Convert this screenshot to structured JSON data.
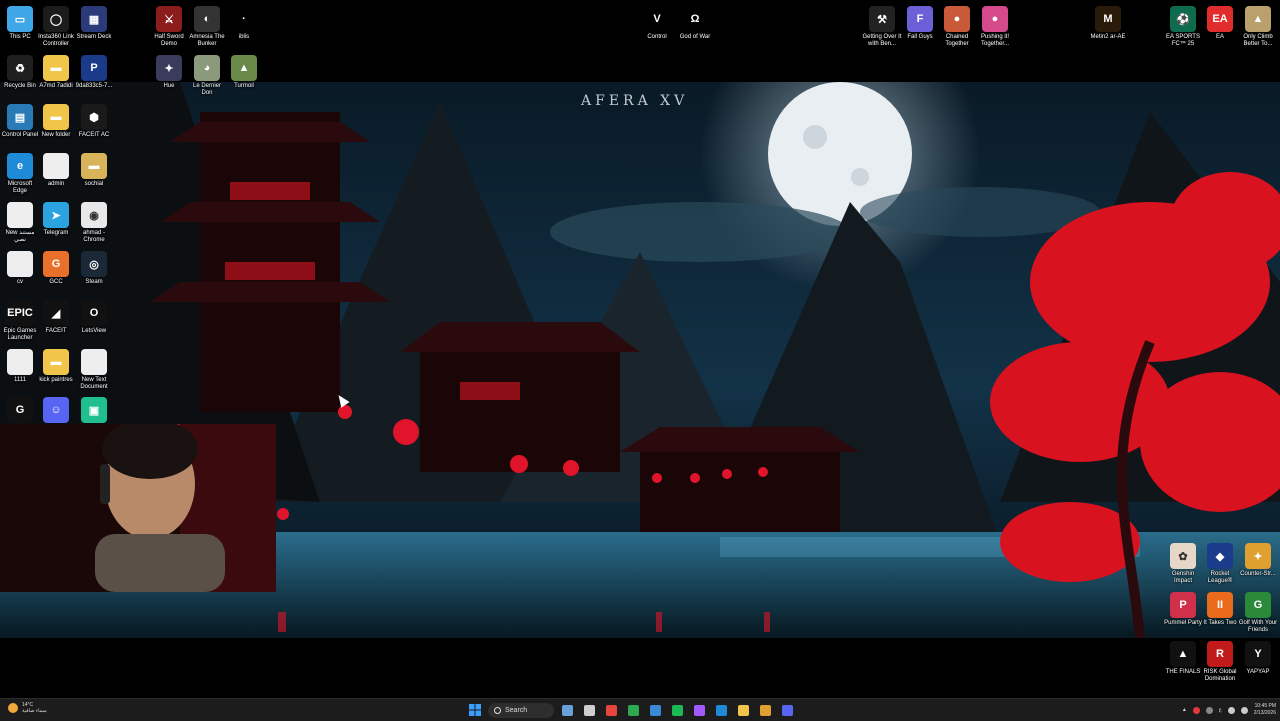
{
  "wallpaper": {
    "title": "AFERA XV"
  },
  "desktop": {
    "icons": [
      {
        "id": "this-pc",
        "label": "This PC",
        "color": "#3fa7e8",
        "glyph": "▭"
      },
      {
        "id": "insta360",
        "label": "Insta360 Link Controller",
        "color": "#1c1c1c",
        "glyph": "◯"
      },
      {
        "id": "stream-deck",
        "label": "Stream Deck",
        "color": "#2b3a78",
        "glyph": "▦"
      },
      {
        "id": "half-sword",
        "label": "Half Sword Demo",
        "color": "#8c1d1d",
        "glyph": "⚔"
      },
      {
        "id": "amnesia",
        "label": "Amnesia The Bunker",
        "color": "#333",
        "glyph": "◐"
      },
      {
        "id": "iblis",
        "label": "iblis",
        "color": "#000",
        "glyph": "·"
      },
      {
        "id": "control",
        "label": "Control",
        "color": "#000",
        "glyph": "V"
      },
      {
        "id": "god-of-war",
        "label": "God of War",
        "color": "#000",
        "glyph": "Ω"
      },
      {
        "id": "getting-over-it",
        "label": "Getting Over It with Ben...",
        "color": "#222",
        "glyph": "⚒"
      },
      {
        "id": "fall-guys",
        "label": "Fall Guys",
        "color": "#6c5fd8",
        "glyph": "F"
      },
      {
        "id": "chained-together",
        "label": "Chained Together",
        "color": "#c85a3a",
        "glyph": "●"
      },
      {
        "id": "pushing-it",
        "label": "Pushing it! Together...",
        "color": "#d54a8a",
        "glyph": "●"
      },
      {
        "id": "metin2",
        "label": "Metin2 ar-AE",
        "color": "#2a1a0a",
        "glyph": "M"
      },
      {
        "id": "ea-fc25",
        "label": "EA SPORTS FC™ 25",
        "color": "#0f6b4d",
        "glyph": "⚽"
      },
      {
        "id": "ea",
        "label": "EA",
        "color": "#e02c2c",
        "glyph": "EA"
      },
      {
        "id": "only-climb",
        "label": "Only Climb Better To...",
        "color": "#b9a06c",
        "glyph": "▲"
      },
      {
        "id": "recycle-bin",
        "label": "Recycle Bin",
        "color": "#1f1f1f",
        "glyph": "♻"
      },
      {
        "id": "a7md-folder",
        "label": "A7md 7adidi",
        "color": "#f0c54a",
        "glyph": "▬"
      },
      {
        "id": "pdf-file",
        "label": "9da833c5-7...",
        "color": "#1a3a8a",
        "glyph": "P"
      },
      {
        "id": "hue",
        "label": "Hue",
        "color": "#3b3b5b",
        "glyph": "✦"
      },
      {
        "id": "le-dernier-don",
        "label": "Le Dernier Don",
        "color": "#8a9a7a",
        "glyph": "◕"
      },
      {
        "id": "turmoil",
        "label": "Turmoil",
        "color": "#6a8a4a",
        "glyph": "▲"
      },
      {
        "id": "control-panel",
        "label": "Control Panel",
        "color": "#2a7ab8",
        "glyph": "▤"
      },
      {
        "id": "new-folder",
        "label": "New folder",
        "color": "#f0c54a",
        "glyph": "▬"
      },
      {
        "id": "faceit-ac",
        "label": "FACEIT AC",
        "color": "#1a1a1a",
        "glyph": "⬢"
      },
      {
        "id": "edge",
        "label": "Microsoft Edge",
        "color": "#1e8ad8",
        "glyph": "e"
      },
      {
        "id": "admin",
        "label": "admin",
        "color": "#eee",
        "glyph": ""
      },
      {
        "id": "sochial",
        "label": "sochial",
        "color": "#d8b35a",
        "glyph": "▬"
      },
      {
        "id": "new-doc-arabic",
        "label": "New مستند نصي",
        "color": "#eee",
        "glyph": ""
      },
      {
        "id": "telegram",
        "label": "Telegram",
        "color": "#2aa3e0",
        "glyph": "➤"
      },
      {
        "id": "chrome-ahmad",
        "label": "ahmad - Chrome",
        "color": "#e8e8e8",
        "glyph": "◉"
      },
      {
        "id": "cv",
        "label": "cv",
        "color": "#eee",
        "glyph": ""
      },
      {
        "id": "gcc",
        "label": "GCC",
        "color": "#e8702a",
        "glyph": "G"
      },
      {
        "id": "steam",
        "label": "Steam",
        "color": "#1b2838",
        "glyph": "◎"
      },
      {
        "id": "epic-games",
        "label": "Epic Games Launcher",
        "color": "#111",
        "glyph": "EPIC"
      },
      {
        "id": "faceit",
        "label": "FACEIT",
        "color": "#111",
        "glyph": "◢"
      },
      {
        "id": "letsview",
        "label": "LetsView",
        "color": "#111",
        "glyph": "O"
      },
      {
        "id": "file-1111",
        "label": "1111",
        "color": "#eee",
        "glyph": ""
      },
      {
        "id": "kick-paintres",
        "label": "kick paintres",
        "color": "#f0c54a",
        "glyph": "▬"
      },
      {
        "id": "new-text-doc",
        "label": "New Text Document",
        "color": "#eee",
        "glyph": ""
      },
      {
        "id": "icon-g",
        "label": "",
        "color": "#111",
        "glyph": "G"
      },
      {
        "id": "discord",
        "label": "",
        "color": "#5865f2",
        "glyph": "☺"
      },
      {
        "id": "icon-green",
        "label": "",
        "color": "#1fbf8f",
        "glyph": "▣"
      },
      {
        "id": "genshin",
        "label": "Genshin Impact",
        "color": "#e7d7c8",
        "glyph": "✿"
      },
      {
        "id": "rocket-league",
        "label": "Rocket League®",
        "color": "#1b3c8a",
        "glyph": "◆"
      },
      {
        "id": "counter-strike",
        "label": "Counter-Str...",
        "color": "#e0a030",
        "glyph": "✦"
      },
      {
        "id": "pummel-party",
        "label": "Pummel Party",
        "color": "#d0304a",
        "glyph": "P"
      },
      {
        "id": "it-takes-two",
        "label": "It Takes Two",
        "color": "#e86a1a",
        "glyph": "II"
      },
      {
        "id": "golf-friends",
        "label": "Golf With Your Friends",
        "color": "#2a8a3a",
        "glyph": "G"
      },
      {
        "id": "the-finals",
        "label": "THE FINALS",
        "color": "#111",
        "glyph": "▲"
      },
      {
        "id": "risk",
        "label": "RISK Global Domination",
        "color": "#c01a1a",
        "glyph": "R"
      },
      {
        "id": "yapyap",
        "label": "YAPYAP",
        "color": "#111",
        "glyph": "Y"
      }
    ]
  },
  "taskbar": {
    "weather_temp": "14°C",
    "weather_desc": "سماء صافية",
    "search_label": "Search",
    "clock_time": "10:45 PM",
    "clock_date": "2/13/2026",
    "lang": "ع",
    "apps": [
      {
        "id": "widgets",
        "color": "#6aa0d8"
      },
      {
        "id": "task-view",
        "color": "#cfcfcf"
      },
      {
        "id": "chrome-1",
        "color": "#e8453c"
      },
      {
        "id": "chrome-2",
        "color": "#2da94f"
      },
      {
        "id": "store",
        "color": "#3a8ad8"
      },
      {
        "id": "spotify",
        "color": "#1db954"
      },
      {
        "id": "figma",
        "color": "#a259ff"
      },
      {
        "id": "edge-tb",
        "color": "#1e8ad8"
      },
      {
        "id": "explorer",
        "color": "#f0c54a"
      },
      {
        "id": "chrome-3",
        "color": "#e0a030"
      },
      {
        "id": "discord-tb",
        "color": "#5865f2"
      }
    ]
  }
}
